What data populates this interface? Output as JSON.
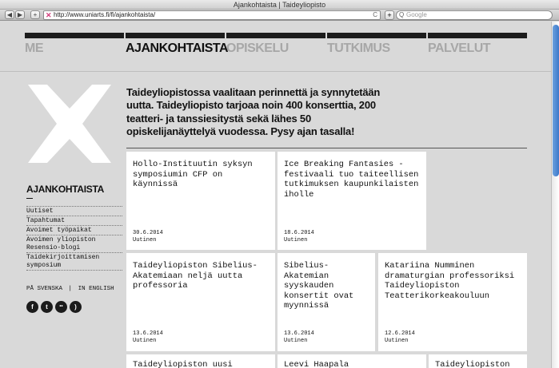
{
  "browser": {
    "window_title": "Ajankohtaista | Taideyliopisto",
    "url": "http://www.uniarts.fi/fi/ajankohtaista/",
    "search_placeholder": "Google",
    "back_glyph": "◀",
    "forward_glyph": "▶",
    "add_glyph": "+",
    "reload_glyph": "C",
    "search_glyph": "Q",
    "favicon_glyph": "✕"
  },
  "nav": {
    "items": [
      {
        "label": "ME",
        "active": false
      },
      {
        "label": "AJANKOHTAISTA",
        "active": true
      },
      {
        "label": "OPISKELU",
        "active": false
      },
      {
        "label": "TUTKIMUS",
        "active": false
      },
      {
        "label": "PALVELUT",
        "active": false
      }
    ]
  },
  "intro": {
    "text": "Taideyliopistossa vaalitaan perinnettä ja synnytetään uutta. Taideyliopisto tarjoaa noin 400 konserttia, 200 teatteri- ja tanssiesitystä sekä lähes 50 opiskelijanäyttelyä vuodessa. Pysy ajan tasalla!"
  },
  "sidebar": {
    "heading": "AJANKOHTAISTA",
    "items": [
      {
        "label": "Uutiset"
      },
      {
        "label": "Tapahtumat"
      },
      {
        "label": "Avoimet työpaikat"
      },
      {
        "label": "Avoimen yliopiston Resensio-blogi"
      },
      {
        "label": "Taidekirjoittamisen symposium"
      }
    ],
    "lang_swedish": "PÅ SVENSKA",
    "lang_sep": "|",
    "lang_english": "IN ENGLISH",
    "social": [
      {
        "icon": "facebook-icon",
        "glyph": "f"
      },
      {
        "icon": "twitter-icon",
        "glyph": "t"
      },
      {
        "icon": "flickr-icon",
        "glyph": "••"
      },
      {
        "icon": "rss-icon",
        "glyph": ")"
      }
    ]
  },
  "cards": [
    {
      "title": "Hollo-Instituutin syksyn symposiumin CFP on käynnissä",
      "date": "30.6.2014",
      "category": "Uutinen"
    },
    {
      "title": "Ice Breaking Fantasies - festivaali tuo taiteellisen tutkimuksen kaupunkilaisten iholle",
      "date": "18.6.2014",
      "category": "Uutinen"
    },
    {
      "title": "Taideyliopiston Sibelius-Akatemiaan neljä uutta professoria",
      "date": "13.6.2014",
      "category": "Uutinen"
    },
    {
      "title": "Sibelius-Akatemian syyskauden konsertit ovat myynnissä",
      "date": "13.6.2014",
      "category": "Uutinen"
    },
    {
      "title": "Katariina Numminen dramaturgian professoriksi Taideyliopiston Teatterikorkeakouluun",
      "date": "12.6.2014",
      "category": "Uutinen"
    },
    {
      "title": "Taideyliopiston uusi",
      "date": "",
      "category": ""
    },
    {
      "title": "Leevi Haapala",
      "date": "",
      "category": ""
    },
    {
      "title": "Taideyliopiston",
      "date": "",
      "category": ""
    }
  ],
  "colors": {
    "background": "#d9d9d9",
    "nav_bar": "#1c1c1c",
    "nav_inactive": "#a7a7a7",
    "nav_active": "#111111",
    "logo": "#ffffff",
    "card": "#ffffff"
  }
}
